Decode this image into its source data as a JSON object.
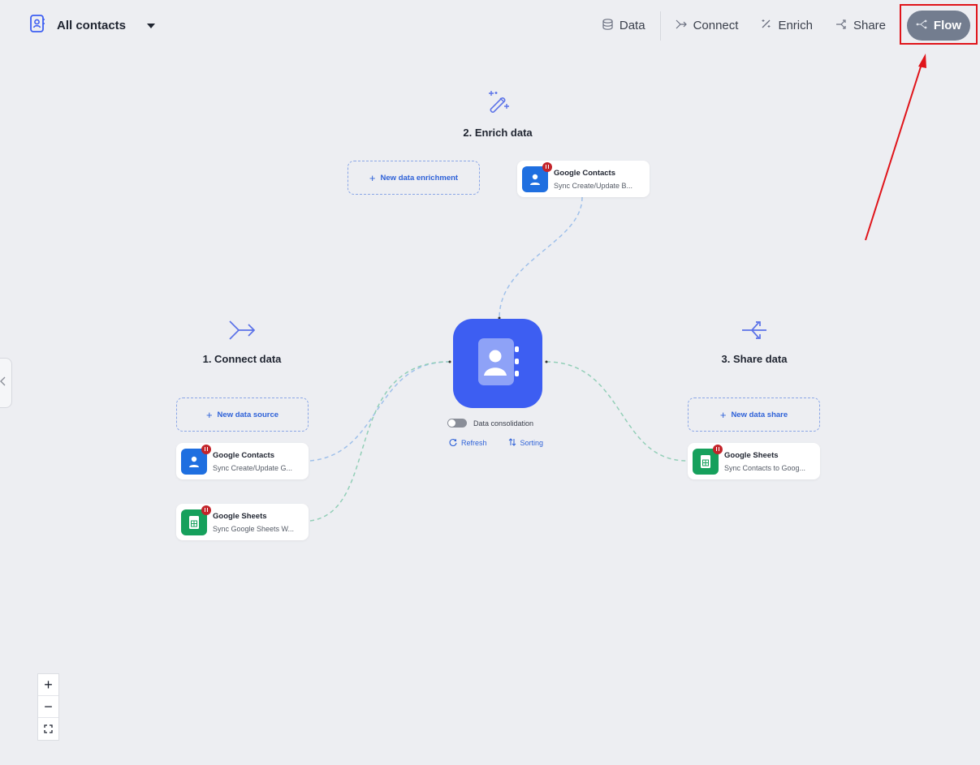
{
  "header": {
    "title": "All contacts",
    "nav": {
      "data": "Data",
      "connect": "Connect",
      "enrich": "Enrich",
      "share": "Share",
      "flow": "Flow"
    }
  },
  "sections": {
    "connect": {
      "label": "1. Connect data",
      "new_label": "New data source",
      "cards": [
        {
          "name": "Google Contacts",
          "desc": "Sync Create/Update G...",
          "app": "google-contacts"
        },
        {
          "name": "Google Sheets",
          "desc": "Sync Google Sheets W...",
          "app": "google-sheets"
        }
      ]
    },
    "enrich": {
      "label": "2. Enrich data",
      "new_label": "New data enrichment",
      "cards": [
        {
          "name": "Google Contacts",
          "desc": "Sync Create/Update B...",
          "app": "google-contacts"
        }
      ]
    },
    "share": {
      "label": "3. Share data",
      "new_label": "New data share",
      "cards": [
        {
          "name": "Google Sheets",
          "desc": "Sync Contacts to Goog...",
          "app": "google-sheets"
        }
      ]
    }
  },
  "hub": {
    "consolidation_label": "Data consolidation",
    "refresh_label": "Refresh",
    "sorting_label": "Sorting"
  },
  "colors": {
    "accent": "#3d5ef2",
    "link": "#2f62d8",
    "highlight": "#e0141a",
    "flow_active": "#737d8f"
  }
}
